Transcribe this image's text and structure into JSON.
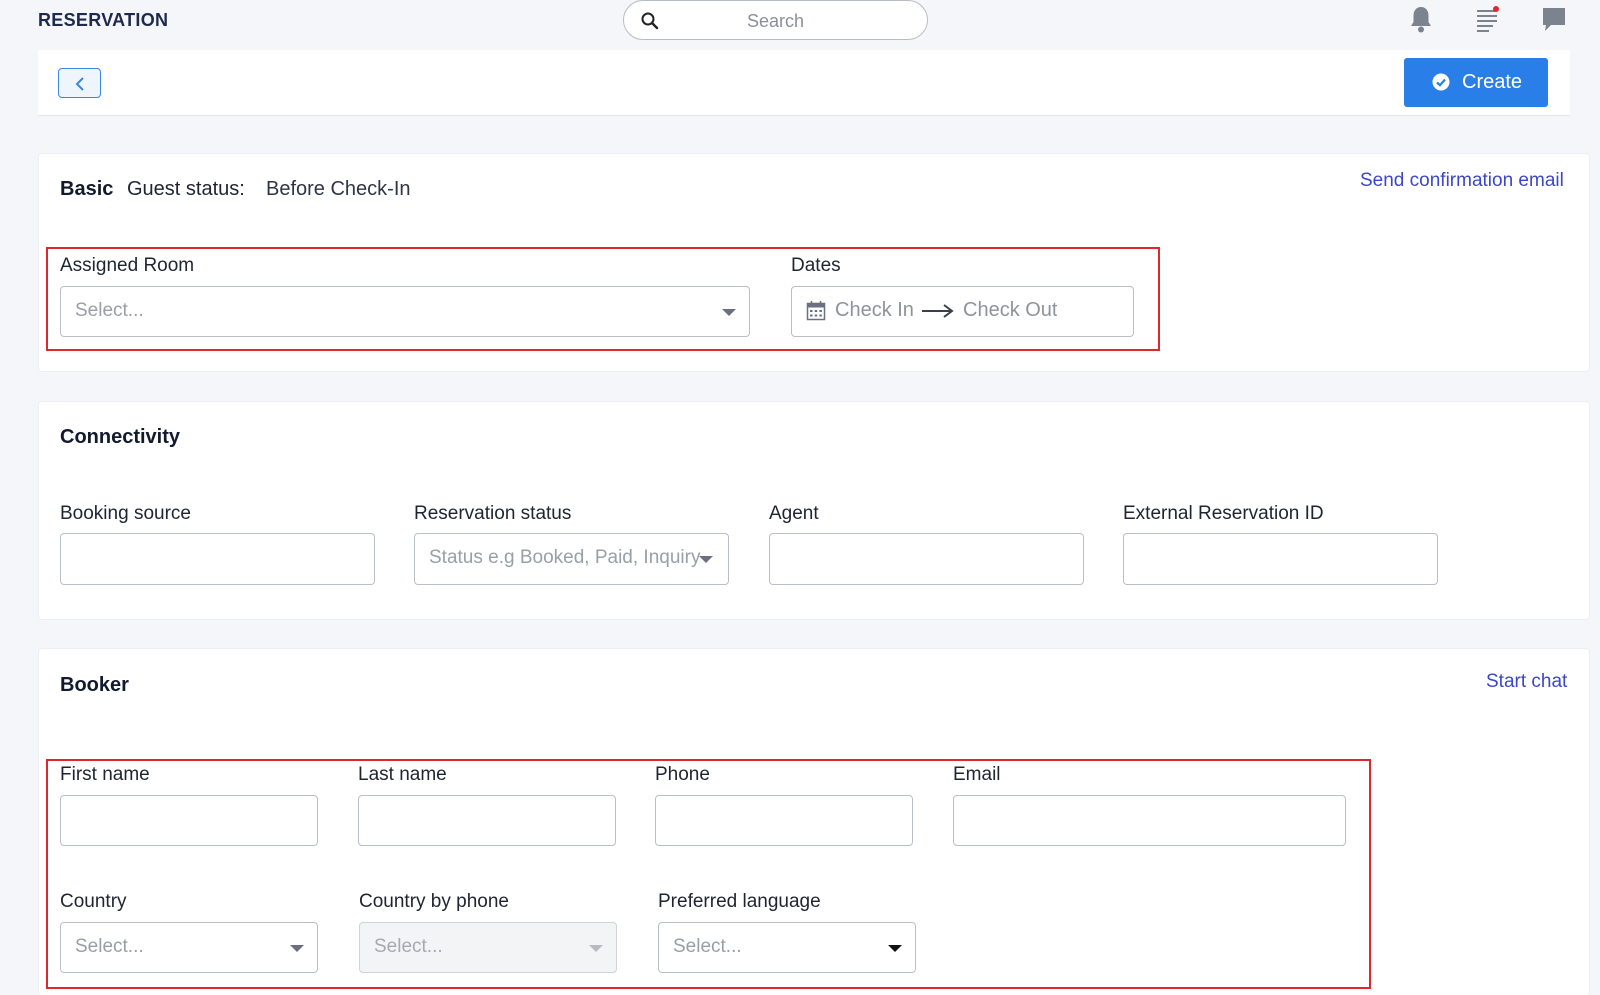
{
  "header": {
    "brand": "RESERVATION",
    "search_placeholder": "Search",
    "icons": [
      "bell-icon",
      "list-icon",
      "chat-icon"
    ]
  },
  "toolbar": {
    "back_icon": "chevron-left-icon",
    "create_label": "Create",
    "create_icon": "check-circle-icon"
  },
  "basic": {
    "title": "Basic",
    "guest_status_label": "Guest status:",
    "guest_status_value": "Before Check-In",
    "send_email_link": "Send confirmation email",
    "assigned_room_label": "Assigned Room",
    "assigned_room_placeholder": "Select...",
    "dates_label": "Dates",
    "check_in_placeholder": "Check In",
    "check_out_placeholder": "Check Out"
  },
  "connectivity": {
    "title": "Connectivity",
    "booking_source_label": "Booking source",
    "reservation_status_label": "Reservation status",
    "reservation_status_placeholder": "Status e.g Booked, Paid, Inquiry",
    "agent_label": "Agent",
    "external_id_label": "External Reservation ID"
  },
  "booker": {
    "title": "Booker",
    "start_chat_link": "Start chat",
    "first_name_label": "First name",
    "last_name_label": "Last name",
    "phone_label": "Phone",
    "email_label": "Email",
    "country_label": "Country",
    "country_placeholder": "Select...",
    "country_by_phone_label": "Country by phone",
    "country_by_phone_placeholder": "Select...",
    "preferred_language_label": "Preferred language",
    "preferred_language_placeholder": "Select..."
  },
  "colors": {
    "accent": "#2a7ee8",
    "link": "#3c47c7",
    "highlight_box": "#e0282c",
    "notification_dot": "#e0282c"
  }
}
